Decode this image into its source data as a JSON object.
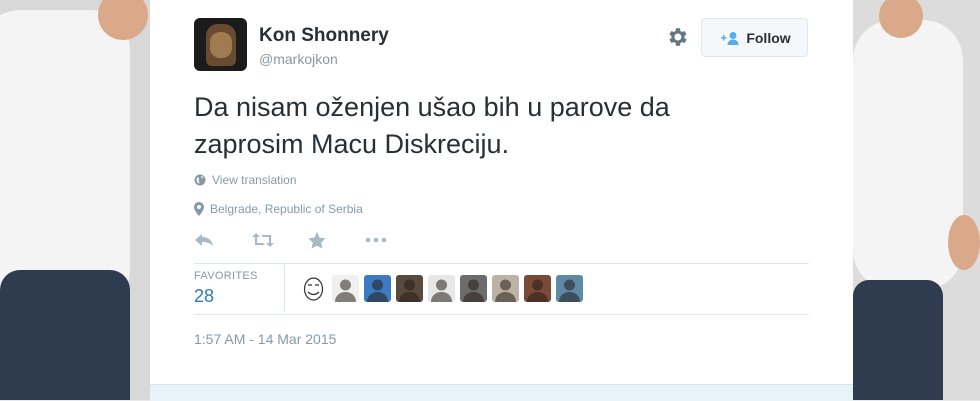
{
  "tweet": {
    "author_name": "Kon Shonnery",
    "author_handle": "@markojkon",
    "follow_label": "Follow",
    "text_line1": "Da nisam oženjen ušao bih u parove da",
    "text_line2": "zaprosim Macu Diskreciju.",
    "view_translation": "View translation",
    "location": "Belgrade, Republic of Serbia",
    "favorites_label": "FAVORITES",
    "favorites_count": "28",
    "timestamp": "1:57 AM - 14 Mar 2015"
  },
  "actions": [
    "reply-icon",
    "retweet-icon",
    "favorite-icon",
    "more-icon"
  ],
  "favoriters": [
    {
      "icon": "meme-face",
      "bg": "#ffffff"
    },
    {
      "icon": "avatar",
      "bg": "#f0f0f0"
    },
    {
      "icon": "avatar",
      "bg": "#3d7ac4"
    },
    {
      "icon": "avatar",
      "bg": "#5a4a3e"
    },
    {
      "icon": "avatar",
      "bg": "#e7e7e7"
    },
    {
      "icon": "avatar",
      "bg": "#6c6c6c"
    },
    {
      "icon": "avatar",
      "bg": "#bdb3a5"
    },
    {
      "icon": "avatar",
      "bg": "#7a4a38"
    },
    {
      "icon": "avatar",
      "bg": "#5d8aa6"
    }
  ],
  "colors": {
    "link": "#2b7bb9",
    "muted": "#8899a6",
    "text": "#292f33",
    "footer": "#e8f2f9"
  }
}
